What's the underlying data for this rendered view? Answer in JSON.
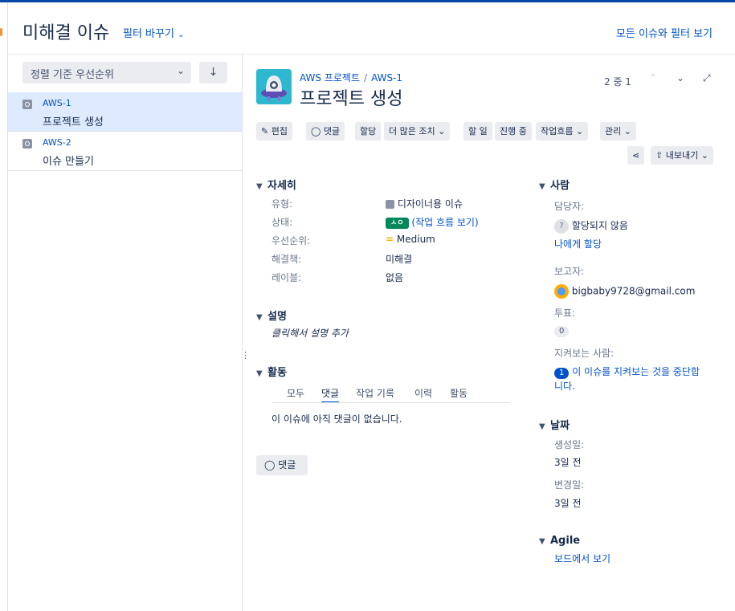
{
  "header": {
    "title": "미해결 이슈",
    "filter_toggle": "필터 바꾸기",
    "all_issues_link": "모든 이슈와 필터 보기"
  },
  "sidebar": {
    "sort_label": "정렬 기준 우선순위",
    "issues": [
      {
        "key": "AWS-1",
        "summary": "프로젝트 생성",
        "selected": true
      },
      {
        "key": "AWS-2",
        "summary": "이슈 만들기",
        "selected": false
      }
    ]
  },
  "issue": {
    "breadcrumb_project": "AWS 프로젝트",
    "breadcrumb_sep": "/",
    "breadcrumb_key": "AWS-1",
    "title": "프로젝트 생성",
    "pager": "2 중 1"
  },
  "toolbar": {
    "edit": "편집",
    "comment": "댓글",
    "assign": "할당",
    "more": "더 많은 조치",
    "todo": "할 일",
    "in_progress": "진행 중",
    "workflow": "작업흐름",
    "admin": "관리",
    "export": "내보내기"
  },
  "details": {
    "section": "자세히",
    "type_label": "유형:",
    "type_value": "디자이너용 이슈",
    "status_label": "상태:",
    "status_value": "ㅅㅇ",
    "status_link": "(작업 흐름 보기)",
    "priority_label": "우선순위:",
    "priority_value": "Medium",
    "resolution_label": "해결책:",
    "resolution_value": "미해결",
    "labels_label": "레이블:",
    "labels_value": "없음"
  },
  "description": {
    "section": "설명",
    "placeholder": "클릭해서 설명 추가"
  },
  "activity": {
    "section": "활동",
    "tabs": [
      "모두",
      "댓글",
      "작업 기록",
      "이력",
      "활동"
    ],
    "active_tab": "댓글",
    "empty": "이 이슈에 아직 댓글이 없습니다.",
    "comment_button": "댓글"
  },
  "people": {
    "section": "사람",
    "assignee_label": "담당자:",
    "assignee_value": "할당되지 않음",
    "assign_me": "나에게 할당",
    "reporter_label": "보고자:",
    "reporter_value": "bigbaby9728@gmail.com",
    "votes_label": "투표:",
    "votes_count": "0",
    "watchers_label": "지켜보는 사람:",
    "watchers_count": "1",
    "watch_link_line1": "이 이슈를 지켜보는 것을 중단합",
    "watch_link_line2": "니다."
  },
  "dates": {
    "section": "날짜",
    "created_label": "생성일:",
    "created_value": "3일 전",
    "updated_label": "변경일:",
    "updated_value": "3일 전"
  },
  "agile": {
    "section": "Agile",
    "board_link": "보드에서 보기"
  },
  "colors": {
    "accent": "#0052cc",
    "selected_row": "#deebff",
    "status_green": "#00875a",
    "priority_medium": "#ffab00"
  }
}
